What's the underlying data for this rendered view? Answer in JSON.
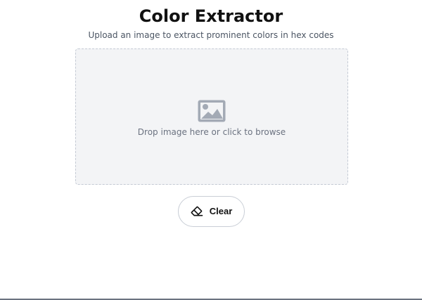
{
  "header": {
    "title": "Color Extractor",
    "subtitle": "Upload an image to extract prominent colors in hex codes"
  },
  "upload": {
    "prompt": "Drop image here or click to browse",
    "icon": "image-icon"
  },
  "actions": {
    "clear_label": "Clear",
    "clear_icon": "eraser-icon"
  },
  "colors": {
    "background": "#ffffff",
    "dropzone_background": "#f3f4f6",
    "dropzone_border": "#c4cad4",
    "muted_text": "#6b7280",
    "icon_gray": "#9ca3af"
  }
}
